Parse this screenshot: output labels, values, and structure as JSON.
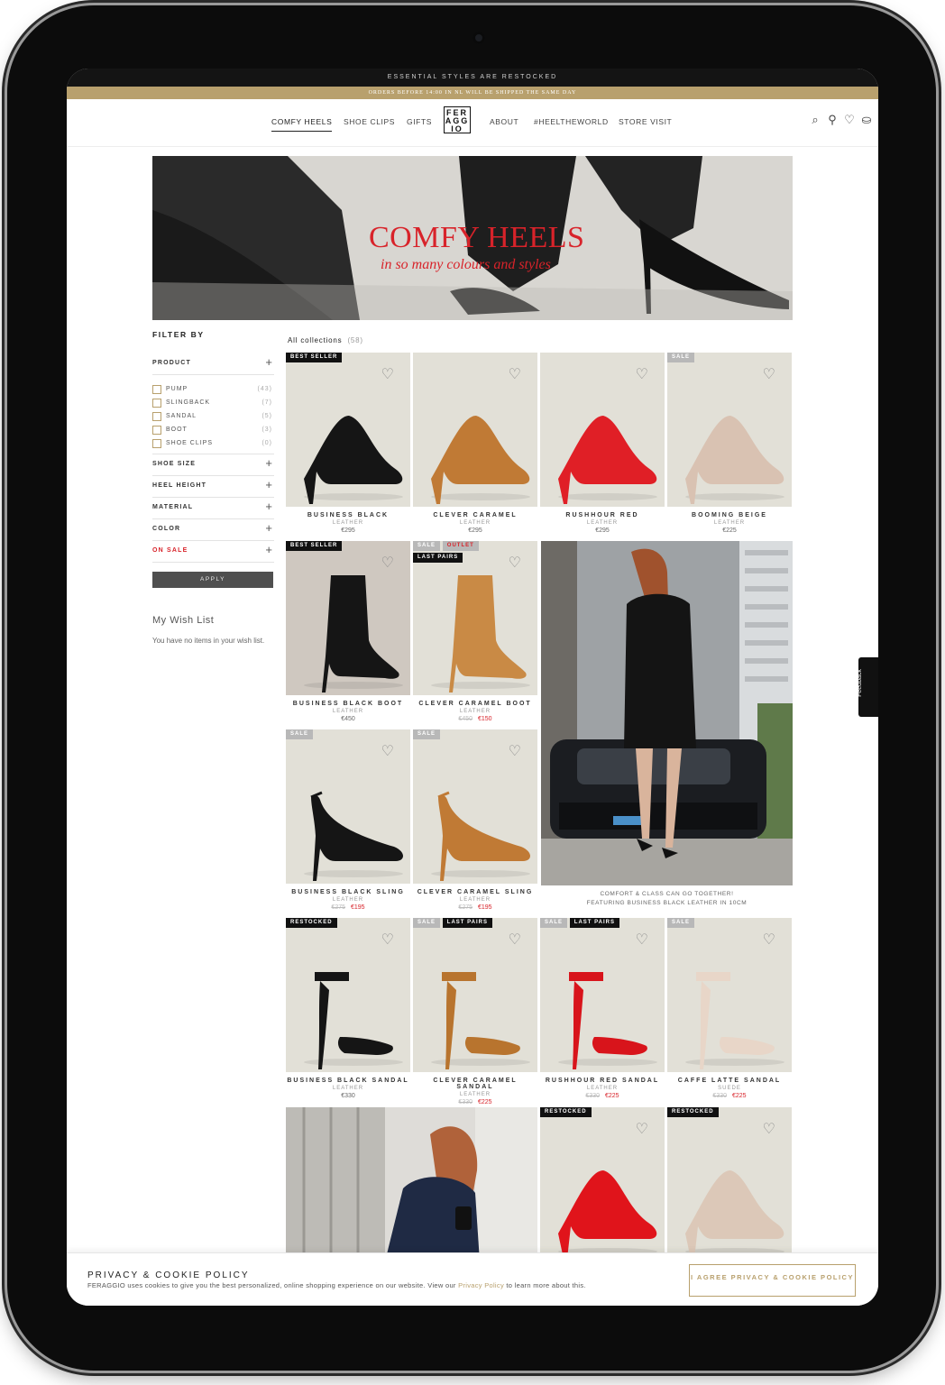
{
  "announcement": "ESSENTIAL STYLES ARE RESTOCKED",
  "shipping": "ORDERS BEFORE 14:00 IN NL WILL BE SHIPPED THE SAME DAY",
  "nav": {
    "items": [
      "COMFY HEELS",
      "SHOE CLIPS",
      "GIFTS",
      "ABOUT",
      "#HEELTHEWORLD",
      "STORE VISIT"
    ],
    "logo": [
      "FER",
      "AGG",
      "IO"
    ]
  },
  "hero": {
    "title": "COMFY HEELS",
    "subtitle": "in so many colours and styles"
  },
  "filter": {
    "title": "FILTER BY",
    "product_label": "PRODUCT",
    "options": [
      {
        "label": "PUMP",
        "count": "(43)"
      },
      {
        "label": "SLINGBACK",
        "count": "(7)"
      },
      {
        "label": "SANDAL",
        "count": "(5)"
      },
      {
        "label": "BOOT",
        "count": "(3)"
      },
      {
        "label": "SHOE CLIPS",
        "count": "(0)"
      }
    ],
    "facets": [
      "SHOE SIZE",
      "HEEL HEIGHT",
      "MATERIAL",
      "COLOR",
      "ON SALE"
    ],
    "apply": "APPLY"
  },
  "wishlist": {
    "title": "My Wish List",
    "empty": "You have no items in your wish list."
  },
  "collection": {
    "label": "All collections",
    "count": "(58)"
  },
  "products": [
    {
      "name": "BUSINESS BLACK",
      "material": "LEATHER",
      "price": "€295",
      "badges": [
        "BEST SELLER"
      ]
    },
    {
      "name": "CLEVER CARAMEL",
      "material": "LEATHER",
      "price": "€295",
      "badges": []
    },
    {
      "name": "RUSHHOUR RED",
      "material": "LEATHER",
      "price": "€295",
      "badges": []
    },
    {
      "name": "BOOMING BEIGE",
      "material": "LEATHER",
      "price": "€225",
      "badges": [
        "SALE"
      ]
    },
    {
      "name": "BUSINESS BLACK BOOT",
      "material": "LEATHER",
      "price": "€450",
      "badges": [
        "BEST SELLER"
      ]
    },
    {
      "name": "CLEVER CARAMEL BOOT",
      "material": "LEATHER",
      "old_price": "€450",
      "price": "€150",
      "badges": [
        "SALE",
        "OUTLET",
        "LAST PAIRS"
      ]
    },
    {
      "name": "BUSINESS BLACK SLING",
      "material": "LEATHER",
      "old_price": "€275",
      "price": "€195",
      "badges": [
        "SALE"
      ]
    },
    {
      "name": "CLEVER CARAMEL SLING",
      "material": "LEATHER",
      "old_price": "€275",
      "price": "€195",
      "badges": [
        "SALE"
      ]
    },
    {
      "name": "BUSINESS BLACK SANDAL",
      "material": "LEATHER",
      "price": "€330",
      "badges": [
        "RESTOCKED"
      ]
    },
    {
      "name": "CLEVER CARAMEL SANDAL",
      "material": "LEATHER",
      "old_price": "€330",
      "price": "€225",
      "badges": [
        "SALE",
        "LAST PAIRS"
      ]
    },
    {
      "name": "RUSHHOUR RED SANDAL",
      "material": "LEATHER",
      "old_price": "€330",
      "price": "€225",
      "badges": [
        "SALE",
        "LAST PAIRS"
      ]
    },
    {
      "name": "CAFFE LATTE SANDAL",
      "material": "SUEDE",
      "old_price": "€330",
      "price": "€225",
      "badges": [
        "SALE"
      ]
    },
    {
      "name": "",
      "material": "",
      "price": "",
      "badges": [
        "RESTOCKED"
      ]
    },
    {
      "name": "",
      "material": "",
      "price": "",
      "badges": [
        "RESTOCKED"
      ]
    }
  ],
  "model_caption": [
    "COMFORT & CLASS CAN GO TOGETHER!",
    "FEATURING BUSINESS BLACK LEATHER IN 10CM"
  ],
  "cookie": {
    "title": "PRIVACY & COOKIE POLICY",
    "text_before": "FERAGGIO uses cookies to give you the best personalized, online shopping experience on our website. View our",
    "link": "Privacy Policy",
    "text_after": "to learn more about this.",
    "button": "I AGREE PRIVACY & COOKIE POLICY"
  },
  "feedback": "Feedback",
  "colors": {
    "accent_gold": "#b8a06d",
    "sale_red": "#d8232a",
    "tile_bg": "#e2e0d7"
  },
  "icons": [
    "search-icon",
    "account-icon",
    "heart-icon",
    "bag-icon"
  ]
}
